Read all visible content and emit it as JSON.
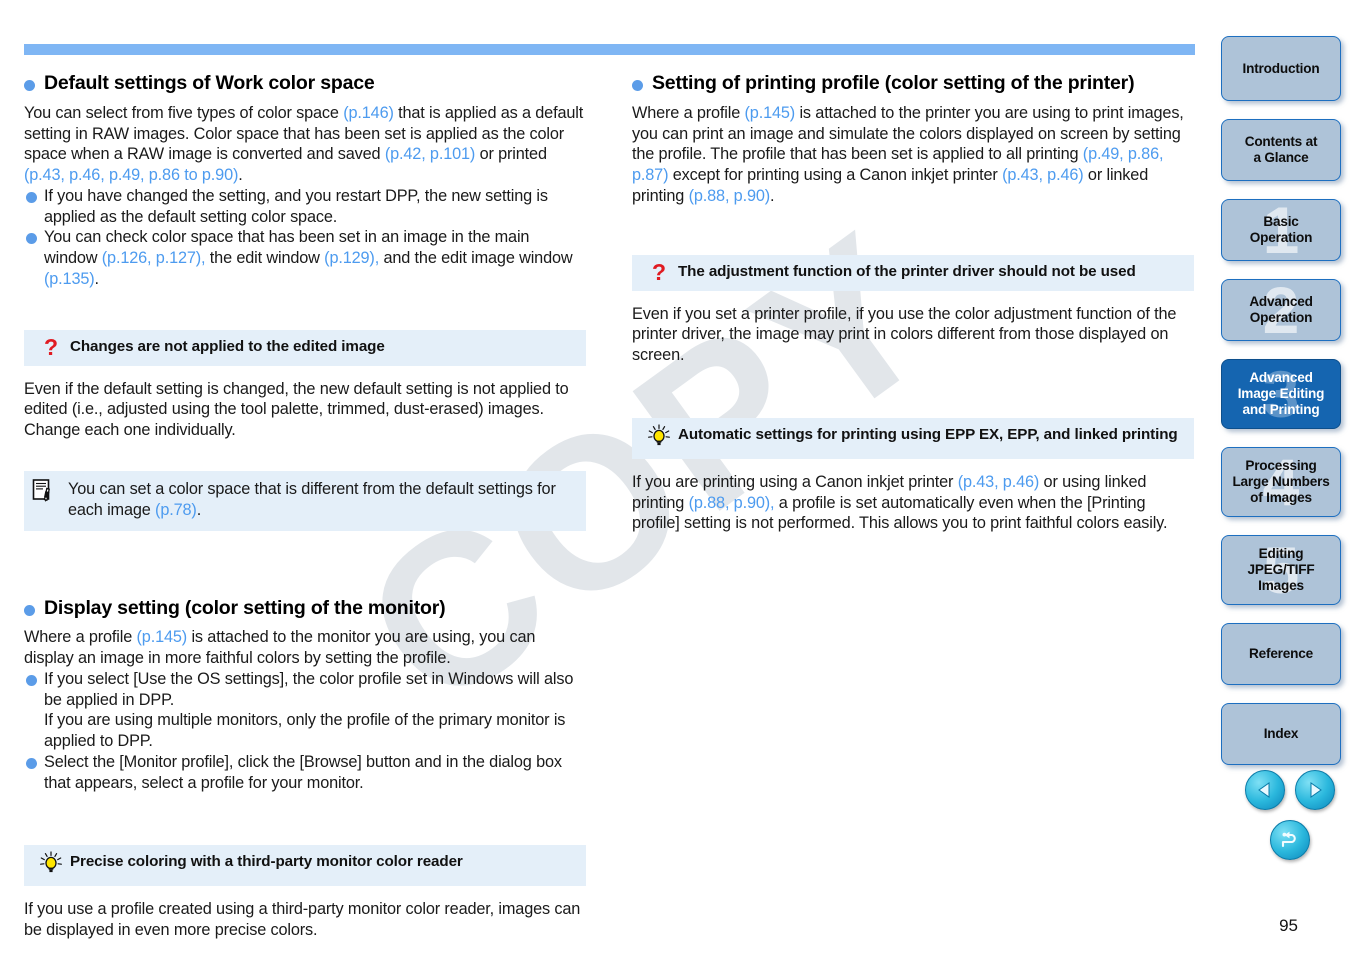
{
  "page": {
    "number": "95",
    "watermark": "COPY",
    "accent_blue": "#7fb6f4",
    "link_blue": "#4d9bef",
    "callout_bg": "#e4eff9",
    "tab_bg": "#aec3d8",
    "tab_active_bg": "#1565b0"
  },
  "left_column": {
    "section1": {
      "heading": "Default settings of Work color space",
      "paragraph": [
        "You can select from five types of color space ",
        "(p.146)",
        " that is applied as a default setting in RAW images. Color space that has been set is applied as the color space when a RAW image is converted and saved ",
        "(p.42, p.101)",
        " or printed ",
        "(p.43, p.46, p.49, p.86 to p.90)",
        "."
      ],
      "bullets": [
        {
          "text_parts": [
            "If you have changed the setting, and you restart DPP, the new setting is applied as the default setting color space."
          ]
        },
        {
          "text_parts": [
            "You can check color space that has been set in an image in the main window ",
            "(p.126, p.127),",
            " the edit window ",
            "(p.129),",
            " and the edit image window ",
            "(p.135)",
            "."
          ]
        }
      ]
    },
    "callout_question": {
      "icon": "question-mark-icon",
      "title": "Changes are not applied to the edited image",
      "body": "Even if the default setting is changed, the new default setting is not applied to edited (i.e., adjusted using the tool palette, trimmed, dust-erased) images. Change each one individually."
    },
    "note": {
      "icon": "memo-note-icon",
      "text_parts": [
        "You can set a color space that is different from the default settings for each image ",
        "(p.78)",
        "."
      ]
    },
    "section2": {
      "heading": "Display setting (color setting of the monitor)",
      "paragraph_parts": [
        "Where a profile ",
        "(p.145)",
        " is attached to the monitor you are using, you can display an image in more faithful colors by setting the profile."
      ],
      "bullets": [
        {
          "lines": [
            "If you select [Use the OS settings], the color profile set in Windows will also be applied in DPP.",
            "If you are using multiple monitors, only the profile of the primary monitor is applied to DPP."
          ]
        },
        {
          "lines": [
            "Select the [Monitor profile], click the [Browse] button and in the dialog box that appears, select a profile for your monitor."
          ]
        }
      ]
    },
    "callout_tip": {
      "icon": "lightbulb-icon",
      "title": "Precise coloring with a third-party monitor color reader",
      "body": "If you use a profile created using a third-party monitor color reader, images can be displayed in even more precise colors."
    }
  },
  "right_column": {
    "section1": {
      "heading": "Setting of printing profile (color setting of the printer)",
      "paragraph_parts": [
        "Where a profile ",
        "(p.145)",
        " is attached to the printer you are using to print images, you can print an image and simulate the colors displayed on screen by setting the profile. The profile that has been set is applied to all printing ",
        "(p.49, p.86, p.87)",
        " except for printing using a Canon inkjet printer ",
        "(p.43, p.46)",
        " or linked printing ",
        "(p.88, p.90)",
        "."
      ]
    },
    "callout_question": {
      "icon": "question-mark-icon",
      "title": "The adjustment function of the printer driver should not be used",
      "body": "Even if you set a printer profile, if you use the color adjustment function of the printer driver, the image may print in colors different from those displayed on screen."
    },
    "callout_tip": {
      "icon": "lightbulb-icon",
      "title": "Automatic settings for printing using EPP EX, EPP, and linked printing",
      "body_parts": [
        "If you are printing using a Canon inkjet printer ",
        "(p.43, p.46)",
        " or using linked printing ",
        "(p.88, p.90),",
        " a profile is set automatically even when the [Printing profile] setting is not performed. This allows you to print faithful colors easily."
      ]
    }
  },
  "rail": {
    "tabs": [
      {
        "label": "Introduction",
        "number": "",
        "active": false
      },
      {
        "label": "Contents at\na Glance",
        "number": "",
        "active": false
      },
      {
        "label": "Basic\nOperation",
        "number": "1",
        "active": false
      },
      {
        "label": "Advanced\nOperation",
        "number": "2",
        "active": false
      },
      {
        "label": "Advanced\nImage Editing\nand Printing",
        "number": "3",
        "active": true
      },
      {
        "label": "Processing\nLarge Numbers\nof Images",
        "number": "4",
        "active": false
      },
      {
        "label": "Editing\nJPEG/TIFF\nImages",
        "number": "5",
        "active": false
      },
      {
        "label": "Reference",
        "number": "",
        "active": false
      },
      {
        "label": "Index",
        "number": "",
        "active": false
      }
    ]
  },
  "nav_buttons": [
    {
      "name": "previous-page-button",
      "icon": "triangle-left-icon"
    },
    {
      "name": "next-page-button",
      "icon": "triangle-right-icon"
    },
    {
      "name": "return-button",
      "icon": "return-arrow-icon"
    }
  ]
}
